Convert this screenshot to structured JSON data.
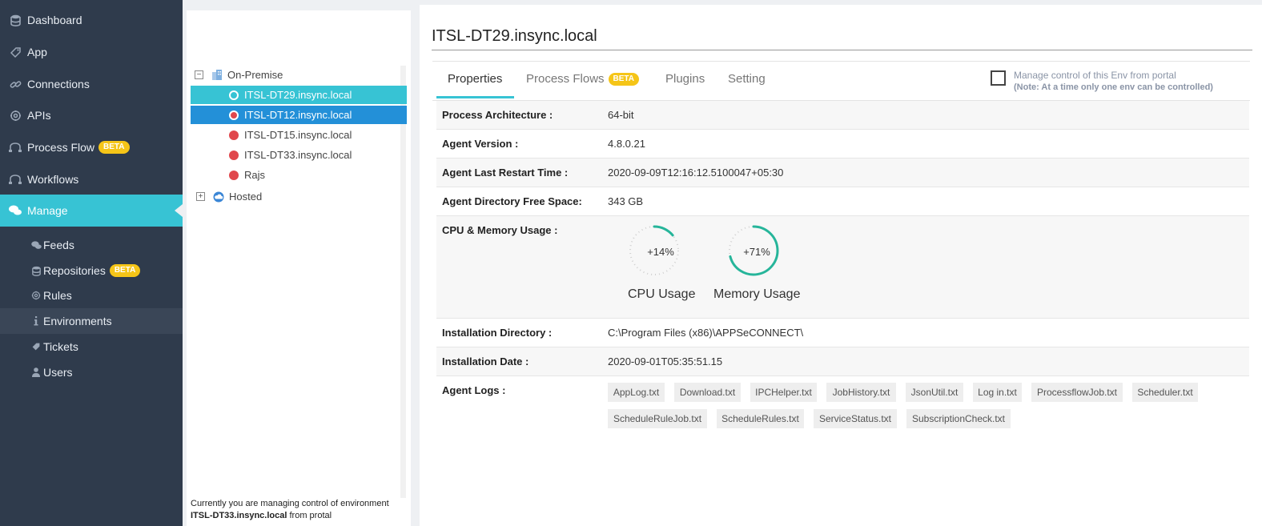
{
  "sidebar": {
    "items": [
      {
        "label": "Dashboard",
        "icon": "database-icon"
      },
      {
        "label": "App",
        "icon": "tag-icon"
      },
      {
        "label": "Connections",
        "icon": "link-icon"
      },
      {
        "label": "APIs",
        "icon": "gear-icon"
      },
      {
        "label": "Process Flow",
        "icon": "flow-icon",
        "badge": "BETA"
      },
      {
        "label": "Workflows",
        "icon": "flow-icon"
      },
      {
        "label": "Manage",
        "icon": "chat-icon"
      }
    ],
    "subitems": [
      {
        "label": "Feeds",
        "icon": "chat-icon"
      },
      {
        "label": "Repositories",
        "icon": "database-icon",
        "badge": "BETA"
      },
      {
        "label": "Rules",
        "icon": "gear-icon"
      },
      {
        "label": "Environments",
        "icon": "info-icon"
      },
      {
        "label": "Tickets",
        "icon": "tag-icon"
      },
      {
        "label": "Users",
        "icon": "user-icon"
      }
    ]
  },
  "tree": {
    "on_premise": "On-Premise",
    "hosted": "Hosted",
    "envs": [
      "ITSL-DT29.insync.local",
      "ITSL-DT12.insync.local",
      "ITSL-DT15.insync.local",
      "ITSL-DT33.insync.local",
      "Rajs"
    ],
    "footer_prefix": "Currently you are managing control of environment",
    "footer_env": "ITSL-DT33.insync.local",
    "footer_suffix": "from protal"
  },
  "main": {
    "title": "ITSL-DT29.insync.local",
    "tabs": [
      "Properties",
      "Process Flows",
      "Plugins",
      "Setting"
    ],
    "tab_badge": "BETA",
    "manage_control": "Manage control of this Env from portal",
    "manage_note": "(Note: At a time only one env can be controlled)",
    "properties": {
      "arch_label": "Process Architecture :",
      "arch_value": "64-bit",
      "version_label": "Agent Version :",
      "version_value": "4.8.0.21",
      "restart_label": "Agent Last Restart Time :",
      "restart_value": "2020-09-09T12:16:12.5100047+05:30",
      "space_label": "Agent Directory Free Space:",
      "space_value": "343 GB",
      "usage_label": "CPU & Memory Usage :",
      "install_dir_label": "Installation Directory :",
      "install_dir_value": "C:\\Program Files (x86)\\APPSeCONNECT\\",
      "install_date_label": "Installation Date :",
      "install_date_value": "2020-09-01T05:35:51.15",
      "logs_label": "Agent Logs :"
    },
    "cpu": {
      "label": "CPU Usage",
      "pct_text": "+14%",
      "value": 14
    },
    "memory": {
      "label": "Memory Usage",
      "pct_text": "+71%",
      "value": 71
    },
    "logs": [
      "AppLog.txt",
      "Download.txt",
      "IPCHelper.txt",
      "JobHistory.txt",
      "JsonUtil.txt",
      "Log in.txt",
      "ProcessflowJob.txt",
      "Scheduler.txt",
      "ScheduleRuleJob.txt",
      "ScheduleRules.txt",
      "ServiceStatus.txt",
      "SubscriptionCheck.txt"
    ]
  },
  "colors": {
    "accent": "#37c3d4",
    "selected_blue": "#2390d8",
    "status_red": "#e0474c",
    "badge": "#f5c518",
    "gauge": "#26b59a"
  }
}
